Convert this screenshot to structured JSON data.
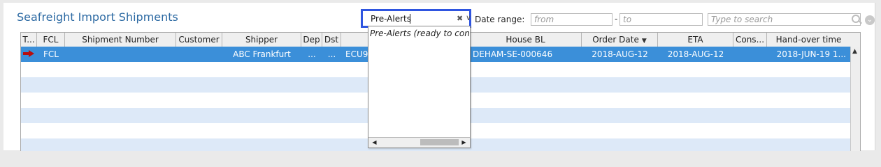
{
  "title": "Seafreight Import Shipments",
  "filter": {
    "value": "Pre-Alerts"
  },
  "date_range": {
    "label": "Date range:",
    "from_placeholder": "from",
    "dash": "-",
    "to_placeholder": "to"
  },
  "search": {
    "placeholder": "Type to search"
  },
  "columns": [
    {
      "label": "T..."
    },
    {
      "label": "FCL"
    },
    {
      "label": "Shipment Number"
    },
    {
      "label": "Customer"
    },
    {
      "label": "Shipper"
    },
    {
      "label": "Dep"
    },
    {
      "label": "Dst"
    },
    {
      "label": ""
    },
    {
      "label": "House BL"
    },
    {
      "label": "Order Date"
    },
    {
      "label": "ETA"
    },
    {
      "label": "Cons..."
    },
    {
      "label": "Hand-over time"
    }
  ],
  "selected_row": {
    "fcl": "FCL",
    "shipper": "ABC Frankfurt",
    "dep": "...",
    "dst": "...",
    "shipment_ref": "ECU9",
    "house_bl": "DEHAM-SE-000646",
    "order_date": "2018-AUG-12",
    "eta": "2018-AUG-12",
    "handover": "2018-JUN-19 1..."
  },
  "dropdown": {
    "item": "Pre-Alerts (ready to con"
  },
  "colors": {
    "accent_blue": "#2f55e0",
    "selected_row": "#3b8fd9",
    "alt_row": "#dde9f8",
    "title": "#2d6aa3"
  }
}
